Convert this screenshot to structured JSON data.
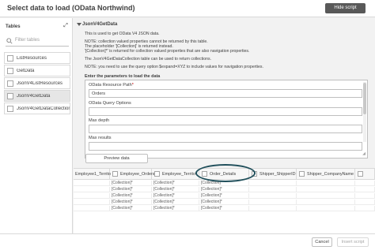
{
  "header": {
    "title": "Select data to load (OData Northwind)",
    "hide_script_label": "Hide script"
  },
  "left_panel": {
    "tables_label": "Tables",
    "filter_placeholder": "Filter tables",
    "items": [
      {
        "label": "ListResources",
        "selected": false
      },
      {
        "label": "GetData",
        "selected": false
      },
      {
        "label": "JsonV4ListResources",
        "selected": false
      },
      {
        "label": "JsonV4GetData",
        "selected": true
      },
      {
        "label": "JsonV4GetDataCollection",
        "selected": false
      }
    ]
  },
  "main": {
    "section_title": "JsonV4GetData",
    "info_lines": [
      "This is used to get OData V4 JSON data.",
      "NOTE: collection valued properties cannot be returned by this table.",
      "The placeholder '[Collection]' is returned instead.",
      "'[Collection]*' is returned for collection valued properties that are also navigation properties.",
      "The JsonV4GetDataCollection table can be used to return collections.",
      "NOTE: you need to use the query option $expand=XYZ to include values for navigation properties."
    ],
    "enter_params_label": "Enter the parameters to load the data",
    "params": [
      {
        "label": "OData Resource Path",
        "required": "*",
        "value": "Orders"
      },
      {
        "label": "OData Query Options",
        "required": "",
        "value": ""
      },
      {
        "label": "Max depth",
        "required": "",
        "value": ""
      },
      {
        "label": "Max results",
        "required": "",
        "value": ""
      }
    ],
    "preview_label": "Preview data"
  },
  "grid": {
    "columns": [
      {
        "label": "Employee1_Territo",
        "has_checkbox": false
      },
      {
        "label": "Employee_Orders",
        "has_checkbox": true
      },
      {
        "label": "Employee_Territo",
        "has_checkbox": true
      },
      {
        "label": "Order_Details",
        "has_checkbox": true
      },
      {
        "label": "Shipper_ShipperID",
        "has_checkbox": true
      },
      {
        "label": "Shipper_CompanyName",
        "has_checkbox": true
      },
      {
        "label": "",
        "has_checkbox": true
      }
    ],
    "rows": [
      [
        "",
        "[Collection]*",
        "[Collection]*",
        "[Collection]*",
        "",
        "",
        ""
      ],
      [
        "",
        "[Collection]*",
        "[Collection]*",
        "[Collection]*",
        "",
        "",
        ""
      ],
      [
        "",
        "[Collection]*",
        "[Collection]*",
        "[Collection]*",
        "",
        "",
        ""
      ],
      [
        "",
        "[Collection]*",
        "[Collection]*",
        "[Collection]*",
        "",
        "",
        ""
      ],
      [
        "",
        "[Collection]*",
        "[Collection]*",
        "[Collection]*",
        "",
        "",
        ""
      ]
    ]
  },
  "footer": {
    "cancel_label": "Cancel",
    "insert_label": "Insert script"
  },
  "colors": {
    "hide_script_bg": "#595959",
    "highlight_ring": "#1f4e5a",
    "selected_item_bg": "#e6e6e6"
  }
}
